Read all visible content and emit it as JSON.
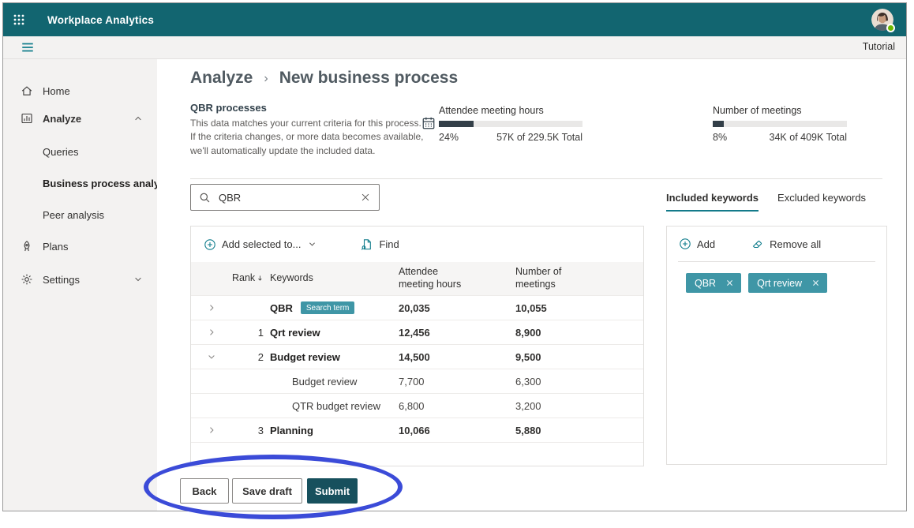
{
  "topbar": {
    "title": "Workplace Analytics"
  },
  "subbar": {
    "tutorial_link": "Tutorial"
  },
  "sidebar": {
    "items": [
      {
        "label": "Home"
      },
      {
        "label": "Analyze"
      },
      {
        "label": "Queries"
      },
      {
        "label": "Business process analysis",
        "selected": true
      },
      {
        "label": "Peer analysis"
      },
      {
        "label": "Plans"
      },
      {
        "label": "Settings"
      }
    ]
  },
  "breadcrumb": {
    "section": "Analyze",
    "separator": "›",
    "page": "New business process"
  },
  "process": {
    "title": "QBR processes",
    "description": "This data matches your current criteria for this process. If the criteria changes, or more data becomes available, we'll automatically update the included data."
  },
  "metrics": [
    {
      "label": "Attendee meeting hours",
      "percent": "24%",
      "fill_pct": 24,
      "total": "57K of 229.5K Total"
    },
    {
      "label": "Number of meetings",
      "percent": "8%",
      "fill_pct": 8,
      "total": "34K of 409K Total"
    }
  ],
  "search": {
    "value": "QBR"
  },
  "table": {
    "toolbar": {
      "add_selected_label": "Add selected to...",
      "find_label": "Find"
    },
    "columns": {
      "rank": "Rank",
      "keywords": "Keywords",
      "hours": "Attendee meeting hours",
      "meetings": "Number of meetings"
    },
    "sort": {
      "column": "Rank",
      "direction": "descending"
    },
    "rows": [
      {
        "rank": "",
        "keyword": "QBR",
        "badge": "Search term",
        "hours": "20,035",
        "meetings": "10,055",
        "expandable": true
      },
      {
        "rank": "1",
        "keyword": "Qrt review",
        "hours": "12,456",
        "meetings": "8,900",
        "expandable": true
      },
      {
        "rank": "2",
        "keyword": "Budget review",
        "hours": "14,500",
        "meetings": "9,500",
        "expandable": true,
        "expanded": true
      },
      {
        "keyword": "Budget review",
        "hours": "7,700",
        "meetings": "6,300",
        "child": true
      },
      {
        "keyword": "QTR budget review",
        "hours": "6,800",
        "meetings": "3,200",
        "child": true
      },
      {
        "rank": "3",
        "keyword": "Planning",
        "hours": "10,066",
        "meetings": "5,880",
        "expandable": true
      }
    ]
  },
  "keywords_panel": {
    "tabs": [
      {
        "label": "Included keywords",
        "active": true
      },
      {
        "label": "Excluded keywords",
        "active": false
      }
    ],
    "add_label": "Add",
    "remove_all_label": "Remove all",
    "chips": [
      {
        "label": "QBR"
      },
      {
        "label": "Qrt review"
      }
    ]
  },
  "footer": {
    "back": "Back",
    "save_draft": "Save draft",
    "submit": "Submit"
  },
  "colors": {
    "topbar_teal": "#126570",
    "accent_teal": "#117d8c",
    "chip_teal": "#3f96a6",
    "submit_teal": "#17505d",
    "progress_fill": "#333f48",
    "highlight_blue": "#3b4bd8",
    "presence_green": "#6bb700"
  }
}
